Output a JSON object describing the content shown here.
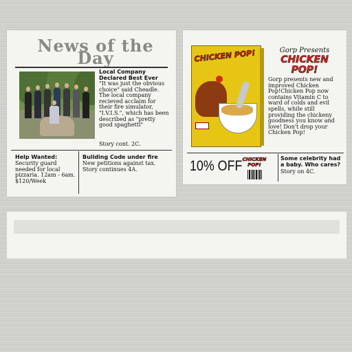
{
  "left_page": {
    "masthead": "News of the Day",
    "main_story": {
      "headline": "Local Company Declared Best Ever",
      "body": "\"It was just the obvious choice\" said Cheadle. The local company recieved acclaim for their fire simulator, \"I.V.I.S.\", which has been described as \"pretty good spaghetti\"",
      "continuation": "Story cont. 2C."
    },
    "classified": {
      "headline": "Help Wanted:",
      "body": "Security guard needed for local pizzaria. 12am - 6am. $120/Week"
    },
    "building_story": {
      "headline": "Building Code under fire",
      "body": "New petitions against tax. Story continues 4A."
    }
  },
  "right_page": {
    "ad_kicker": "Gorp Presents",
    "ad_title": "CHICKEN POP!",
    "box_brand": "CHICKEN POP!",
    "ad_body": "Gorp presents new and improved Chicken Pop!Chicken Pop now contains Vitamin C to ward of colds and evil spells, while still providing the chickeny goodness you know and love! Don't drop your Chicken Pop!",
    "coupon": {
      "discount": "10% OFF",
      "brand": "CHICKEN POP!"
    },
    "celebrity_story": {
      "headline": "Some celebrity had a baby. Who cares?",
      "body": "Story on 4C."
    }
  },
  "colors": {
    "paper": "#f4f4f0",
    "ink": "#111111",
    "brand_red": "#e8231b",
    "cereal_yellow": "#e6c514"
  }
}
